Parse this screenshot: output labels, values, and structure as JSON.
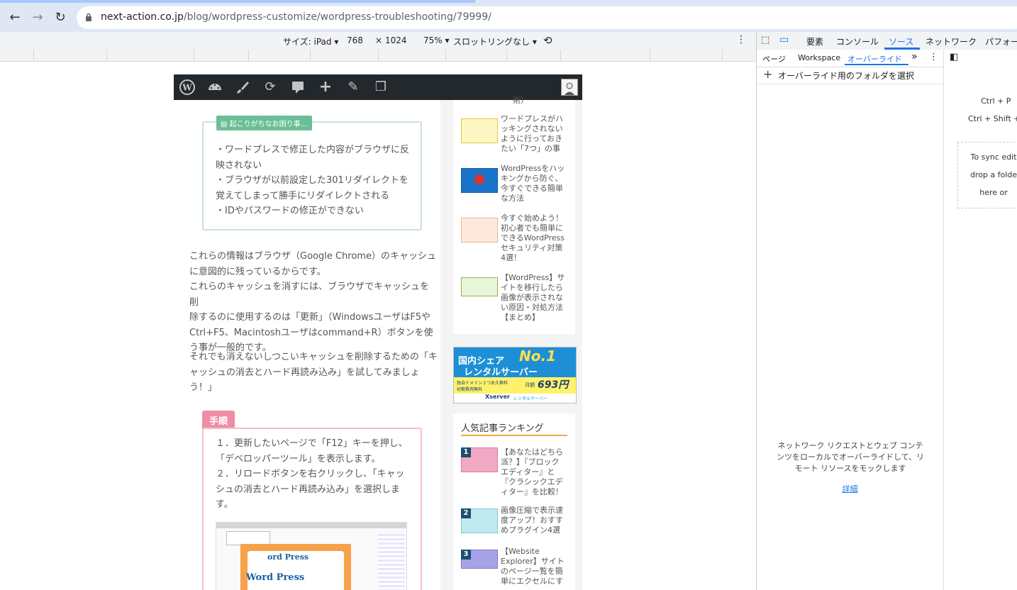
{
  "browser": {
    "url_host": "next-action.co.jp",
    "url_path": "/blog/wordpress-customize/wordpress-troubleshooting/79999/"
  },
  "device_toolbar": {
    "size_label": "サイズ: iPad ▾",
    "width": "768",
    "times": "×",
    "height": "1024",
    "zoom": "75% ▾",
    "throttle": "スロットリングなし ▾"
  },
  "page": {
    "box1_label": "▤ 起こりがちなお困り事…",
    "box1_lines": [
      "・ワードプレスで修正した内容がブラウザに反",
      "映されない",
      "・ブラウザが以前設定した301リダイレクトを",
      "覚えてしまって勝手にリダイレクトされる",
      "・IDやパスワードの修正ができない"
    ],
    "para1": [
      "これらの情報はブラウザ（Google Chrome）のキャッシュ",
      "に意図的に残っているからです。",
      "これらのキャッシュを消すには、ブラウザでキャッシュを削",
      "除するのに使用するのは「更新」（WindowsユーザはF5や",
      "Ctrl+F5、Macintoshユーザはcommand+R）ボタンを使",
      "う事が一般的です。"
    ],
    "para2": [
      "それでも消えないしつこいキャッシュを削除するための「キ",
      "ャッシュの消去とハード再読み込み」を試してみましょ",
      "う！」"
    ],
    "steps_label": "手順",
    "steps_lines": [
      "１．更新したいページで「F12」キーを押し、",
      "「デベロッパーツール」を表示します。",
      "２．リロードボタンを右クリックし、「キャッ",
      "シュの消去とハード再読み込み」を選択しま",
      "す。"
    ],
    "screenshot_text1": "ord Press",
    "screenshot_text2": "Word Press"
  },
  "sidebar": {
    "partial_top": "術）",
    "articles": [
      {
        "title": [
          "ワードプレスがハ",
          "ッキングされない",
          "ように行っておき",
          "たい「7つ」の事"
        ],
        "thumb_color": "#fff7c2",
        "border": "#e5c53a"
      },
      {
        "title": [
          "WordPressをハッ",
          "キングから防ぐ、",
          "今すぐできる簡単",
          "な方法"
        ],
        "thumb_color": "#1a73c8",
        "border": "#1a5fa0"
      },
      {
        "title": [
          "今すぐ始めよう！",
          "初心者でも簡単に",
          "できるWordPress",
          "セキュリティ対策",
          "4選！"
        ],
        "thumb_color": "#fde9dc",
        "border": "#f0b58c"
      },
      {
        "title": [
          "【WordPress】サ",
          "イトを移行したら",
          "画像が表示されな",
          "い原因・対処方法",
          "【まとめ】"
        ],
        "thumb_color": "#e8f5d8",
        "border": "#8bb85a"
      }
    ],
    "ad": {
      "line1": "国内シェア",
      "no1": "No.1",
      "line2": "レンタルサーバー",
      "check1": "独自ドメイン２つ永久無料",
      "check2": "初期費用無料",
      "price": "693円~",
      "price_prefix": "月額",
      "brand": "Xserver",
      "brand_sub": "レンタルサーバー"
    },
    "ranking_title": "人気記事ランキング",
    "ranking": [
      {
        "rank": "1",
        "title": [
          "【あなたはどちら",
          "派？】『ブロック",
          "エディター』と",
          "『クラシックエデ",
          "ィター』を比較！"
        ],
        "thumb_color": "#f2a9c4"
      },
      {
        "rank": "2",
        "title": [
          "画像圧縮で表示速",
          "度アップ！おすす",
          "めプラグイン4選"
        ],
        "thumb_color": "#bfe9ef"
      },
      {
        "rank": "3",
        "title": [
          "【Website",
          "Explorer】サイト",
          "のページ一覧を簡",
          "単にエクセルにす"
        ],
        "thumb_color": "#a8a3e8"
      }
    ]
  },
  "devtools": {
    "tabs": [
      "要素",
      "コンソール",
      "ソース",
      "ネットワーク",
      "パフォー"
    ],
    "active_tab": "ソース",
    "subtabs": [
      "ページ",
      "Workspace",
      "オーバーライド"
    ],
    "active_subtab": "オーバーライド",
    "more": "»",
    "select_folder": "オーバーライド用のフォルダを選択",
    "description": [
      "ネットワーク リクエストとウェブ コンテ",
      "ンツをローカルでオーバーライドして、リ",
      "モート リソースをモックします"
    ],
    "link": "詳細",
    "shortcut1": "Ctrl + P",
    "shortcut2": "Ctrl + Shift + I",
    "sync_text": [
      "To sync edit",
      "drop a folde",
      "here or"
    ]
  },
  "colors": {
    "accent_blue": "#1a73e8",
    "wp_admin_bar": "#23282d",
    "green_box": "#6bbf95",
    "pink_box": "#ef8da5"
  }
}
